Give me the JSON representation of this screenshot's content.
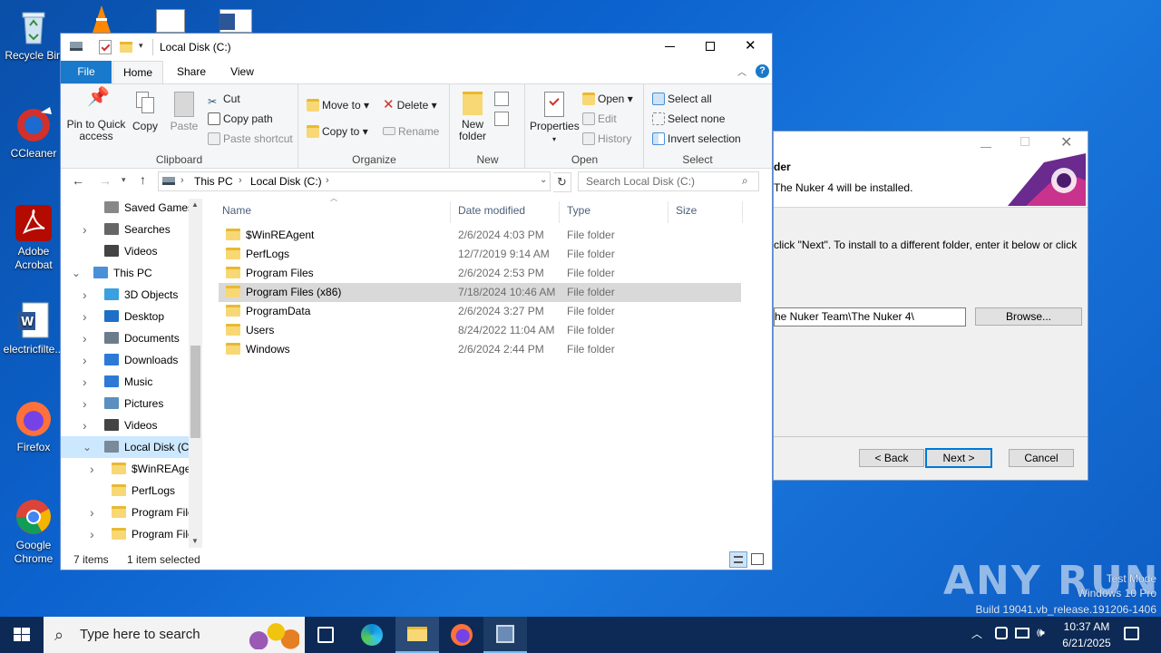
{
  "desktop": {
    "icons": [
      {
        "label": "Recycle Bin"
      },
      {
        "label": "CCleaner"
      },
      {
        "label": "Adobe Acrobat"
      },
      {
        "label": "electricfilte..."
      },
      {
        "label": "Firefox"
      },
      {
        "label": "Google Chrome"
      }
    ],
    "watermark": {
      "line1": "Test Mode",
      "line2": "Windows 10 Pro",
      "line3": "Build 19041.vb_release.191206-1406",
      "brand": "ANY RUN"
    }
  },
  "installer": {
    "heading": "der",
    "subheading": "The Nuker 4 will be installed.",
    "instruction": "click \"Next\". To install to a different folder, enter it below or click",
    "path_value": "he Nuker Team\\The Nuker 4\\",
    "browse_label": "Browse...",
    "back_label": "< Back",
    "next_label": "Next >",
    "cancel_label": "Cancel"
  },
  "explorer": {
    "title": "Local Disk (C:)",
    "tabs": {
      "file": "File",
      "home": "Home",
      "share": "Share",
      "view": "View"
    },
    "ribbon": {
      "clipboard": {
        "label": "Clipboard",
        "pin": "Pin to Quick access",
        "copy": "Copy",
        "paste": "Paste",
        "cut": "Cut",
        "copy_path": "Copy path",
        "paste_shortcut": "Paste shortcut"
      },
      "organize": {
        "label": "Organize",
        "move_to": "Move to",
        "copy_to": "Copy to",
        "delete": "Delete",
        "rename": "Rename"
      },
      "new": {
        "label": "New",
        "new_folder": "New folder"
      },
      "open": {
        "label": "Open",
        "properties": "Properties",
        "open": "Open",
        "edit": "Edit",
        "history": "History"
      },
      "select": {
        "label": "Select",
        "select_all": "Select all",
        "select_none": "Select none",
        "invert": "Invert selection"
      }
    },
    "address": {
      "part1": "This PC",
      "part2": "Local Disk (C:)"
    },
    "search_placeholder": "Search Local Disk (C:)",
    "nav": [
      {
        "label": "Saved Games",
        "icon": "saved-games-icon"
      },
      {
        "label": "Searches",
        "icon": "search-icon"
      },
      {
        "label": "Videos",
        "icon": "videos-icon"
      },
      {
        "label": "This PC",
        "icon": "computer-icon"
      },
      {
        "label": "3D Objects",
        "icon": "3d-objects-icon"
      },
      {
        "label": "Desktop",
        "icon": "desktop-icon"
      },
      {
        "label": "Documents",
        "icon": "documents-icon"
      },
      {
        "label": "Downloads",
        "icon": "downloads-icon"
      },
      {
        "label": "Music",
        "icon": "music-icon"
      },
      {
        "label": "Pictures",
        "icon": "pictures-icon"
      },
      {
        "label": "Videos",
        "icon": "videos-icon"
      },
      {
        "label": "Local Disk (C:)",
        "icon": "drive-icon"
      },
      {
        "label": "$WinREAgent",
        "icon": "folder-icon"
      },
      {
        "label": "PerfLogs",
        "icon": "folder-icon"
      },
      {
        "label": "Program Files",
        "icon": "folder-icon"
      },
      {
        "label": "Program Files",
        "icon": "folder-icon"
      }
    ],
    "columns": {
      "name": "Name",
      "date": "Date modified",
      "type": "Type",
      "size": "Size"
    },
    "files": [
      {
        "name": "$WinREAgent",
        "date": "2/6/2024 4:03 PM",
        "type": "File folder"
      },
      {
        "name": "PerfLogs",
        "date": "12/7/2019 9:14 AM",
        "type": "File folder"
      },
      {
        "name": "Program Files",
        "date": "2/6/2024 2:53 PM",
        "type": "File folder"
      },
      {
        "name": "Program Files (x86)",
        "date": "7/18/2024 10:46 AM",
        "type": "File folder"
      },
      {
        "name": "ProgramData",
        "date": "2/6/2024 3:27 PM",
        "type": "File folder"
      },
      {
        "name": "Users",
        "date": "8/24/2022 11:04 AM",
        "type": "File folder"
      },
      {
        "name": "Windows",
        "date": "2/6/2024 2:44 PM",
        "type": "File folder"
      }
    ],
    "status": {
      "items": "7 items",
      "selected": "1 item selected"
    }
  },
  "taskbar": {
    "search_placeholder": "Type here to search",
    "time": "10:37 AM",
    "date": "6/21/2025"
  },
  "colors": {
    "accent": "#1979ca",
    "selected_row": "#d9d9d9",
    "taskbar": "#0c2a55"
  }
}
